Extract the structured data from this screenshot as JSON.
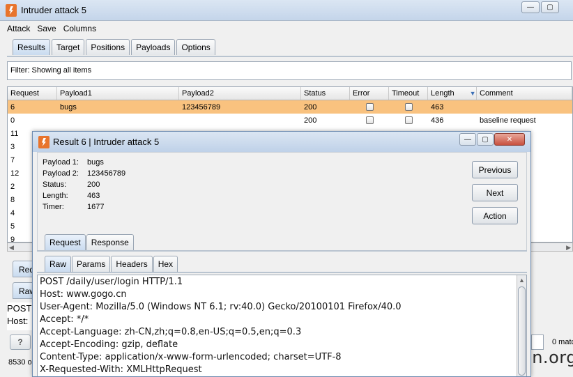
{
  "main_window": {
    "title": "Intruder attack 5",
    "menu": [
      "Attack",
      "Save",
      "Columns"
    ],
    "tabs": [
      "Results",
      "Target",
      "Positions",
      "Payloads",
      "Options"
    ],
    "active_tab": "Results",
    "filter_text": "Filter:  Showing all items",
    "table": {
      "columns": [
        "Request",
        "Payload1",
        "Payload2",
        "Status",
        "Error",
        "Timeout",
        "Length",
        "Comment"
      ],
      "sort_indicator": "▼",
      "rows": [
        {
          "request": "6",
          "payload1": "bugs",
          "payload2": "123456789",
          "status": "200",
          "length": "463",
          "comment": "",
          "selected": true
        },
        {
          "request": "0",
          "payload1": "",
          "payload2": "",
          "status": "200",
          "length": "436",
          "comment": "baseline request",
          "selected": false
        },
        {
          "request": "11",
          "payload1": "",
          "payload2": "",
          "status": "",
          "length": "",
          "comment": "",
          "selected": false
        },
        {
          "request": "3",
          "payload1": "",
          "payload2": "",
          "status": "",
          "length": "",
          "comment": "",
          "selected": false
        },
        {
          "request": "7",
          "payload1": "",
          "payload2": "",
          "status": "",
          "length": "",
          "comment": "",
          "selected": false
        },
        {
          "request": "12",
          "payload1": "",
          "payload2": "",
          "status": "",
          "length": "",
          "comment": "",
          "selected": false
        },
        {
          "request": "2",
          "payload1": "",
          "payload2": "",
          "status": "",
          "length": "",
          "comment": "",
          "selected": false
        },
        {
          "request": "8",
          "payload1": "",
          "payload2": "",
          "status": "",
          "length": "",
          "comment": "",
          "selected": false
        },
        {
          "request": "4",
          "payload1": "",
          "payload2": "",
          "status": "",
          "length": "",
          "comment": "",
          "selected": false
        },
        {
          "request": "5",
          "payload1": "",
          "payload2": "",
          "status": "",
          "length": "",
          "comment": "",
          "selected": false
        },
        {
          "request": "9",
          "payload1": "",
          "payload2": "",
          "status": "",
          "length": "",
          "comment": "",
          "selected": false
        }
      ]
    },
    "bottom_tab_req": "Reque",
    "bottom_tab_raw": "Raw",
    "bottom_text": [
      "POST",
      "Host:",
      "' "
    ],
    "help_label": "?",
    "status_text": "8530 o",
    "matches_text": "0 matc"
  },
  "popup": {
    "title": "Result 6 | Intruder attack 5",
    "info": [
      {
        "key": "Payload 1:",
        "value": "bugs"
      },
      {
        "key": "Payload 2:",
        "value": "123456789"
      },
      {
        "key": "Status:",
        "value": "200"
      },
      {
        "key": "Length:",
        "value": "463"
      },
      {
        "key": "Timer:",
        "value": "1677"
      }
    ],
    "buttons": {
      "previous": "Previous",
      "next": "Next",
      "action": "Action"
    },
    "tabs": [
      "Request",
      "Response"
    ],
    "active_tab": "Request",
    "subtabs": [
      "Raw",
      "Params",
      "Headers",
      "Hex"
    ],
    "active_subtab": "Raw",
    "raw_lines": [
      "POST /daily/user/login HTTP/1.1",
      "Host: www.gogo.cn",
      "User-Agent: Mozilla/5.0 (Windows NT 6.1; rv:40.0) Gecko/20100101 Firefox/40.0",
      "Accept: */*",
      "Accept-Language: zh-CN,zh;q=0.8,en-US;q=0.5,en;q=0.3",
      "Accept-Encoding: gzip, deflate",
      "Content-Type: application/x-www-form-urlencoded; charset=UTF-8",
      "X-Requested-With: XMLHttpRequest"
    ]
  },
  "window_controls": {
    "minimize": "—",
    "maximize": "▢",
    "close": "✕"
  },
  "watermark": "www.wooyun.org",
  "colors": {
    "selected_row": "#f9c27f",
    "logo": "#e8742c",
    "titlebar": "#c4d5ea"
  }
}
